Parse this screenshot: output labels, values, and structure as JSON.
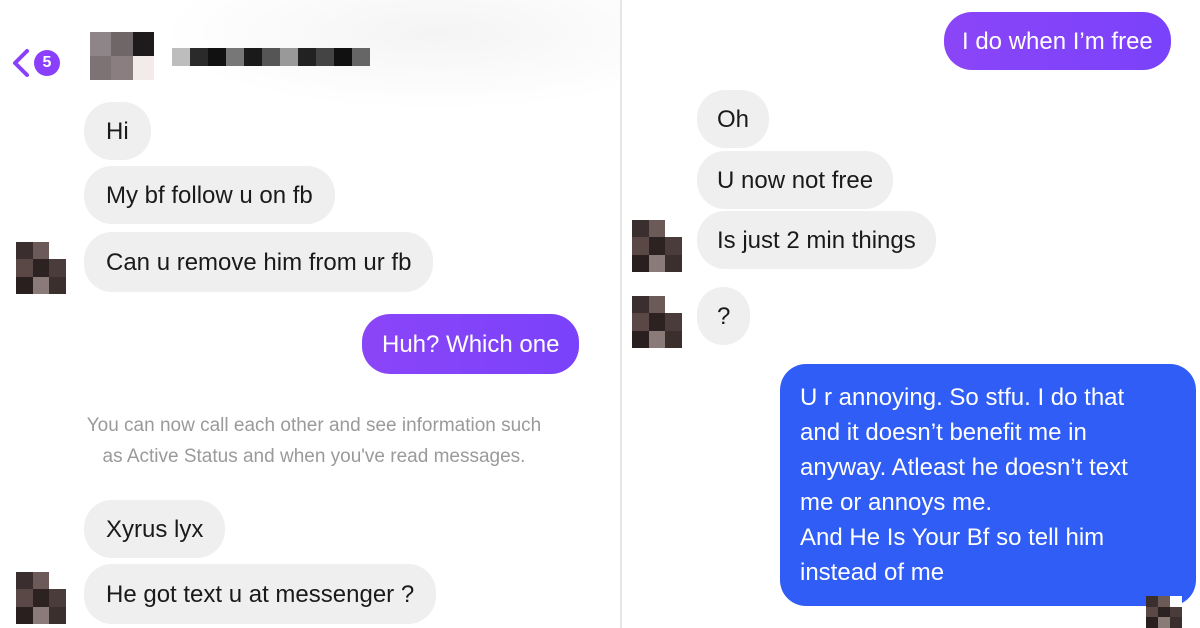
{
  "header": {
    "back_label": "<",
    "unread_badge": "5",
    "contact_name_censored": true
  },
  "left_panel": {
    "messages": [
      {
        "side": "incoming",
        "text": "Hi"
      },
      {
        "side": "incoming",
        "text": "My bf follow u on fb"
      },
      {
        "side": "incoming",
        "text": "Can u remove him from ur fb"
      },
      {
        "side": "outgoing",
        "text": "Huh? Which one"
      },
      {
        "side": "incoming",
        "text": "Xyrus lyx"
      },
      {
        "side": "incoming",
        "text": "He got text u at messenger ?"
      }
    ],
    "system_note": {
      "line1": "You can now call each other and see information such",
      "line2": "as Active Status and when you've read messages."
    }
  },
  "right_panel": {
    "messages": [
      {
        "side": "outgoing",
        "text": "I do when I’m free"
      },
      {
        "side": "incoming",
        "text": "Oh"
      },
      {
        "side": "incoming",
        "text": "U now not free"
      },
      {
        "side": "incoming",
        "text": "Is just 2 min things"
      },
      {
        "side": "incoming",
        "text": "?"
      }
    ],
    "long_reply": {
      "lines": [
        "U r annoying. So stfu. I do that",
        "and it doesn’t benefit me in",
        "anyway. Atleast he doesn’t text",
        "me or annoys me.",
        "And He Is Your Bf so tell him",
        "instead of me"
      ]
    }
  },
  "colors": {
    "outgoing_purple": "#8a3ffc",
    "outgoing_blue": "#2f5df5",
    "incoming_bg": "#efefef",
    "system_text": "#9a9a9a"
  }
}
